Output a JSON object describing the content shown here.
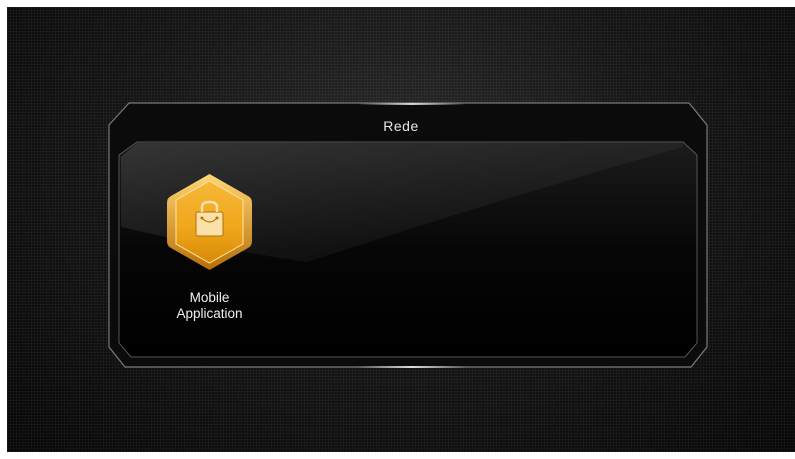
{
  "dialog": {
    "title": "Rede"
  },
  "apps": [
    {
      "label_line1": "Mobile",
      "label_line2": "Application",
      "icon": "shopping-bag-icon",
      "icon_color": "#f0a81c"
    }
  ],
  "colors": {
    "background": "#0a0a0a",
    "panel": "#050505",
    "frame_border": "#8a8a8a",
    "accent_gold": "#f0a81c",
    "text": "#e6e6e6"
  }
}
